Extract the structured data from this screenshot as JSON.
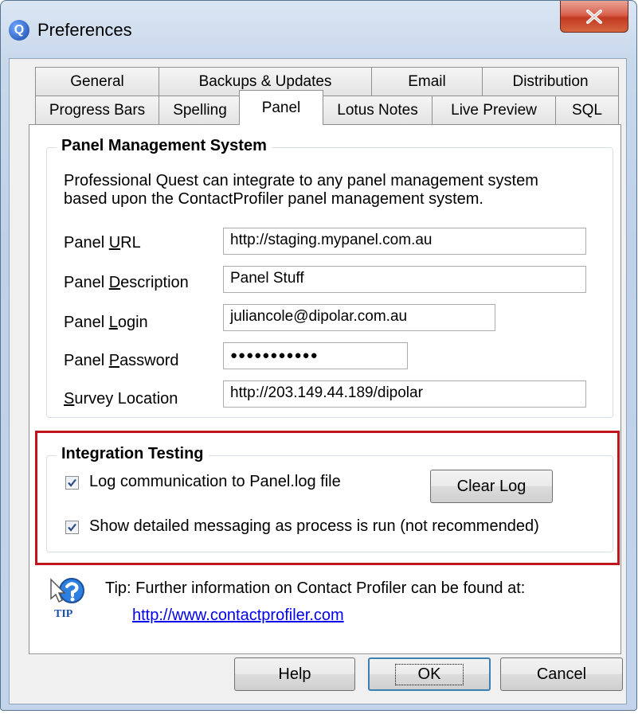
{
  "window": {
    "title": "Preferences",
    "app_icon_letter": "Q",
    "close_glyph": "X"
  },
  "tabs": {
    "row_back": [
      "General",
      "Backups & Updates",
      "Email",
      "Distribution"
    ],
    "row_front": [
      "Progress Bars",
      "Spelling",
      "Panel",
      "Lotus Notes",
      "Live Preview",
      "SQL"
    ],
    "selected": "Panel"
  },
  "panel_management": {
    "legend": "Panel Management System",
    "description_line1": "Professional Quest can integrate to any panel management system",
    "description_line2": "based upon the ContactProfiler panel management system.",
    "fields": [
      {
        "label_pre": "Panel ",
        "label_key": "U",
        "label_post": "RL",
        "value": "http://staging.mypanel.com.au"
      },
      {
        "label_pre": "Panel ",
        "label_key": "D",
        "label_post": "escription",
        "value": "Panel Stuff"
      },
      {
        "label_pre": "Panel ",
        "label_key": "L",
        "label_post": "ogin",
        "value": "juliancole@dipolar.com.au"
      },
      {
        "label_pre": "Panel ",
        "label_key": "P",
        "label_post": "assword",
        "value": "●●●●●●●●●●●"
      },
      {
        "label_pre": "",
        "label_key": "S",
        "label_post": "urvey Location",
        "value": "http://203.149.44.189/dipolar"
      }
    ]
  },
  "integration_testing": {
    "legend": "Integration Testing",
    "log_checkbox_label": "Log communication to Panel.log file",
    "log_checked": true,
    "detail_checkbox_label": "Show detailed messaging as process is run (not recommended)",
    "detail_checked": true,
    "clear_log_label": "Clear Log"
  },
  "tip": {
    "icon_caption": "TIP",
    "text": "Tip: Further information on Contact Profiler can be found at:",
    "link": "http://www.contactprofiler.com"
  },
  "buttons": {
    "help": "Help",
    "ok": "OK",
    "cancel": "Cancel"
  },
  "colors": {
    "highlight_border": "#c0151d",
    "link": "#0000ee",
    "default_button_border": "#3c7fb1"
  }
}
